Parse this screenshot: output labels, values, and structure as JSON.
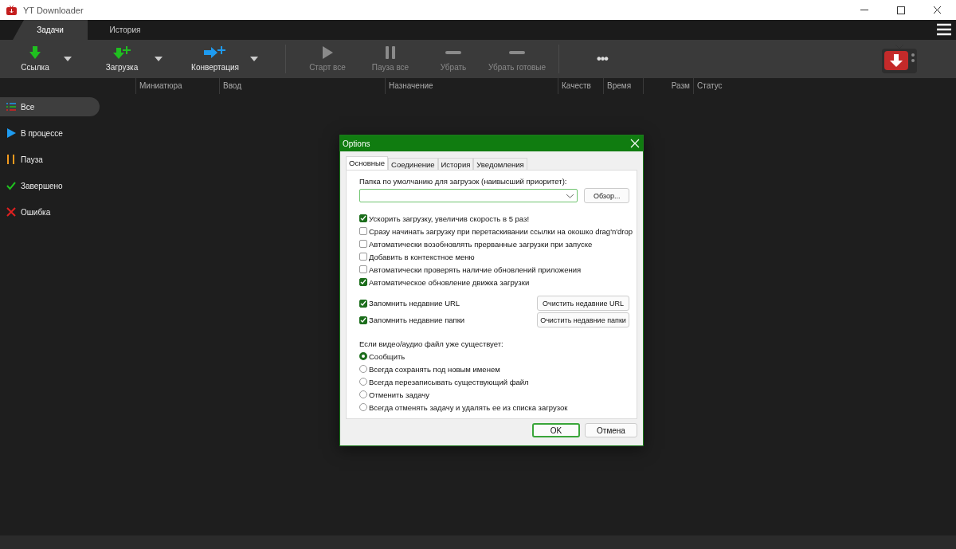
{
  "window": {
    "title": "YT Downloader"
  },
  "tabs": [
    {
      "label": "Задачи",
      "selected": true
    },
    {
      "label": "История",
      "selected": false
    }
  ],
  "toolbar": [
    {
      "kind": "link",
      "label": "Ссылка",
      "disabled": false,
      "dropdown": true
    },
    {
      "kind": "download",
      "label": "Загрузка",
      "disabled": false,
      "dropdown": true
    },
    {
      "kind": "convert",
      "label": "Конвертация",
      "disabled": false,
      "dropdown": true
    },
    {
      "kind": "start",
      "label": "Старт все",
      "disabled": true,
      "dropdown": false
    },
    {
      "kind": "pause",
      "label": "Пауза все",
      "disabled": true,
      "dropdown": false
    },
    {
      "kind": "remove",
      "label": "Убрать",
      "disabled": true,
      "dropdown": false
    },
    {
      "kind": "remove",
      "label": "Убрать готовые",
      "disabled": true,
      "dropdown": false
    },
    {
      "kind": "more",
      "label": "•••"
    }
  ],
  "table": {
    "columns": [
      "Миниатюра",
      "Ввод",
      "Назначение",
      "Качеств",
      "Время",
      "Разм",
      "Статус"
    ]
  },
  "sidebar": {
    "items": [
      {
        "kind": "all",
        "label": "Все",
        "selected": true
      },
      {
        "kind": "progress",
        "label": "В процессе",
        "selected": false
      },
      {
        "kind": "paused",
        "label": "Пауза",
        "selected": false
      },
      {
        "kind": "done",
        "label": "Завершено",
        "selected": false
      },
      {
        "kind": "error",
        "label": "Ошибка",
        "selected": false
      }
    ]
  },
  "dialog": {
    "title": "Options",
    "tabs": [
      {
        "label": "Основные",
        "selected": true
      },
      {
        "label": "Соединение",
        "selected": false
      },
      {
        "label": "История",
        "selected": false
      },
      {
        "label": "Уведомления",
        "selected": false
      }
    ],
    "folder_label": "Папка по умолчанию для загрузок (наивысший приоритет):",
    "browse_button": "Обзор...",
    "checkboxes": [
      {
        "label": "Ускорить загрузку, увеличив скорость в 5 раз!",
        "checked": true
      },
      {
        "label": "Сразу начинать загрузку при перетаскивании ссылки на окошко drag'n'drop",
        "checked": false
      },
      {
        "label": "Автоматически возобновлять прерванные загрузки при запуске",
        "checked": false
      },
      {
        "label": "Добавить в контекстное меню",
        "checked": false
      },
      {
        "label": "Автоматически проверять наличие обновлений приложения",
        "checked": false
      },
      {
        "label": "Автоматическое обновление движка загрузки",
        "checked": true
      }
    ],
    "remember": [
      {
        "label": "Запомнить недавние URL",
        "checked": true,
        "button": "Очистить недавние URL"
      },
      {
        "label": "Запомнить недавние папки",
        "checked": true,
        "button": "Очистить недавние папки"
      }
    ],
    "exists_label": "Если видео/аудио файл уже существует:",
    "radios": [
      {
        "label": "Сообщить",
        "selected": true
      },
      {
        "label": "Всегда сохранять под новым именем",
        "selected": false
      },
      {
        "label": "Всегда перезаписывать существующий файл",
        "selected": false
      },
      {
        "label": "Отменить задачу",
        "selected": false
      },
      {
        "label": "Всегда отменять задачу и удалять ее из списка загрузок",
        "selected": false
      }
    ],
    "ok": "OK",
    "cancel": "Отмена"
  }
}
